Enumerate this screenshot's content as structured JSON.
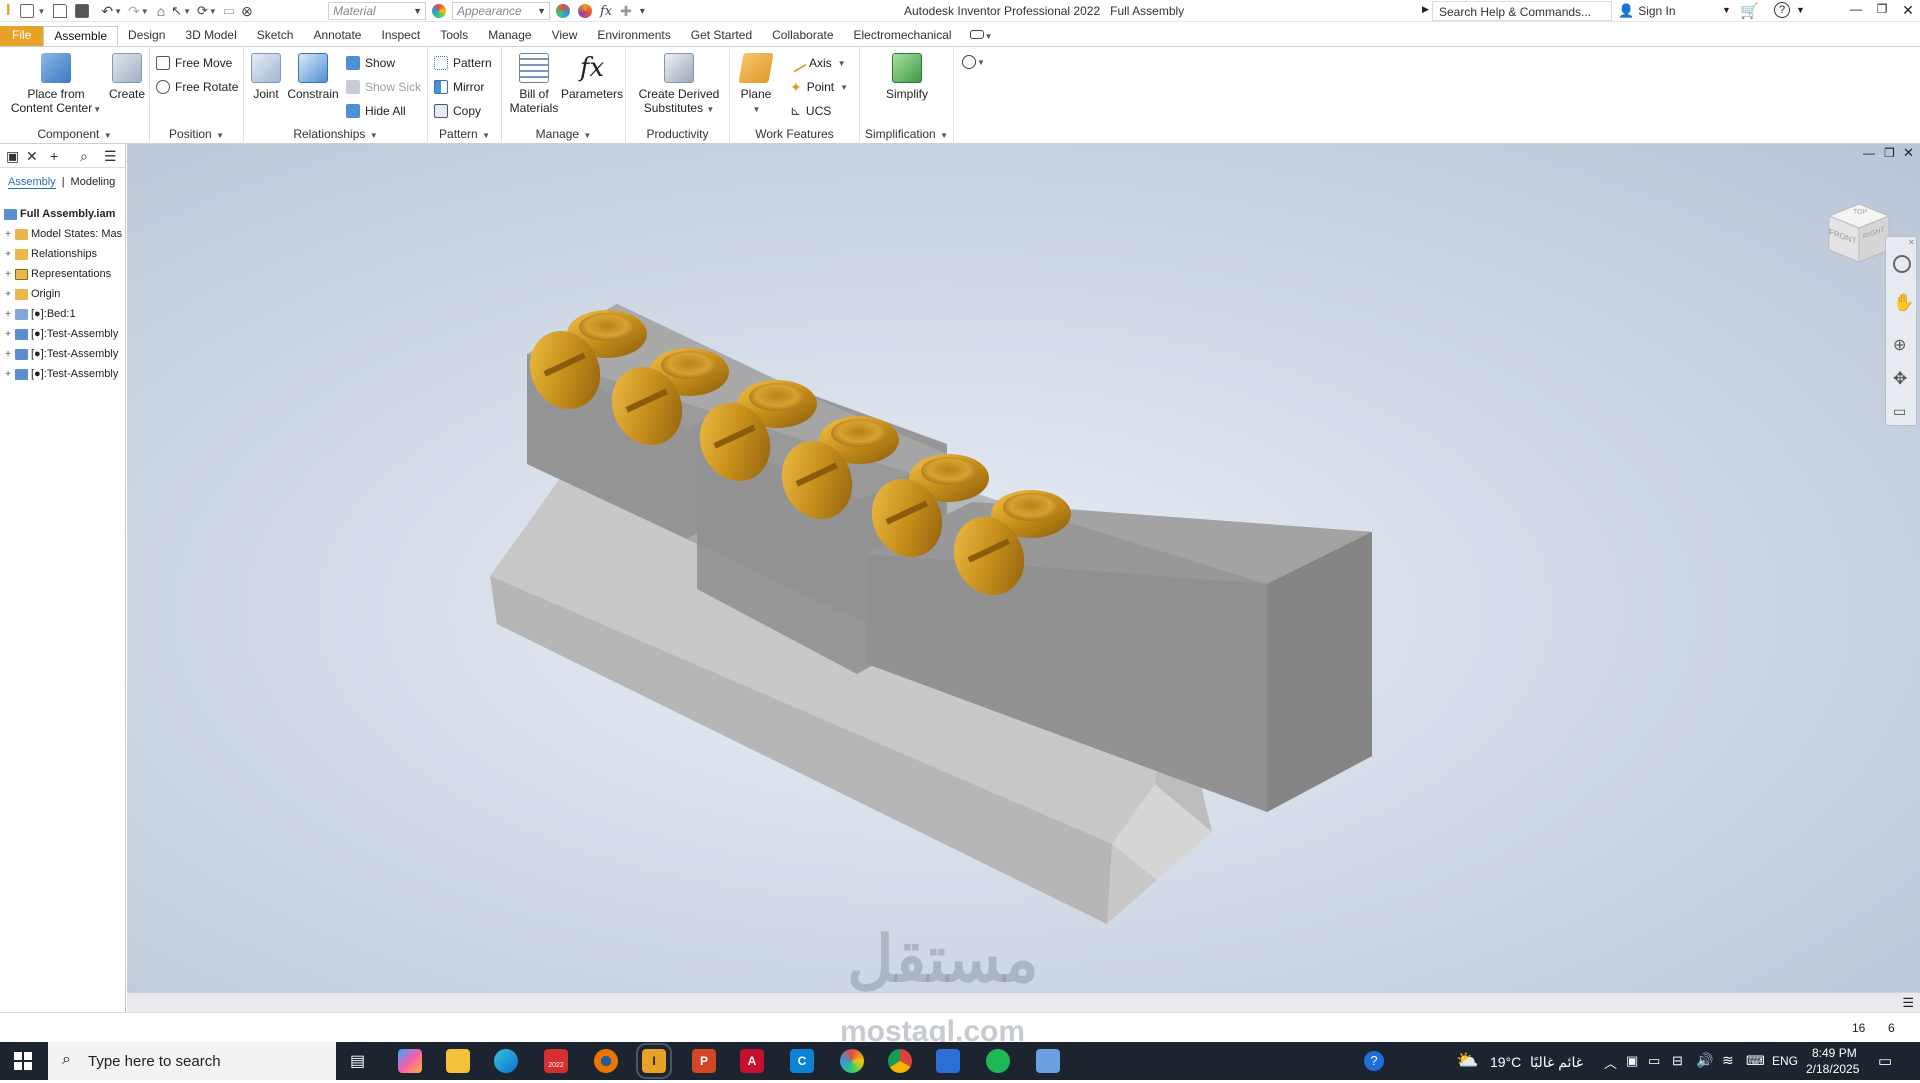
{
  "titlebar": {
    "app_title": "Autodesk Inventor Professional 2022",
    "doc_title": "Full Assembly",
    "material_placeholder": "Material",
    "appearance_placeholder": "Appearance",
    "search_help": "Search Help & Commands...",
    "sign_in": "Sign In"
  },
  "tabs": [
    "File",
    "Assemble",
    "Design",
    "3D Model",
    "Sketch",
    "Annotate",
    "Inspect",
    "Tools",
    "Manage",
    "View",
    "Environments",
    "Get Started",
    "Collaborate",
    "Electromechanical"
  ],
  "active_tab": "Assemble",
  "ribbon": {
    "component": {
      "label": "Component",
      "place_line1": "Place from",
      "place_line2": "Content Center",
      "create": "Create"
    },
    "position": {
      "label": "Position",
      "free_move": "Free Move",
      "free_rotate": "Free Rotate"
    },
    "relationships": {
      "label": "Relationships",
      "joint": "Joint",
      "constrain": "Constrain",
      "show": "Show",
      "show_sick": "Show Sick",
      "hide_all": "Hide All"
    },
    "pattern": {
      "label": "Pattern",
      "pattern": "Pattern",
      "mirror": "Mirror",
      "copy": "Copy"
    },
    "manage": {
      "label": "Manage",
      "bom_line1": "Bill of",
      "bom_line2": "Materials",
      "parameters": "Parameters"
    },
    "productivity": {
      "label": "Productivity",
      "cds_line1": "Create Derived",
      "cds_line2": "Substitutes"
    },
    "work_features": {
      "label": "Work Features",
      "plane": "Plane",
      "axis": "Axis",
      "point": "Point",
      "ucs": "UCS"
    },
    "simplification": {
      "label": "Simplification",
      "simplify": "Simplify"
    }
  },
  "browser": {
    "tabs": [
      "Assembly",
      "Modeling"
    ],
    "nodes": [
      {
        "label": "Full Assembly.iam",
        "root": true
      },
      {
        "label": "Model States: Mas"
      },
      {
        "label": "Relationships"
      },
      {
        "label": "Representations"
      },
      {
        "label": "Origin"
      },
      {
        "label": "[●]:Bed:1"
      },
      {
        "label": "[●]:Test-Assembly"
      },
      {
        "label": "[●]:Test-Assembly"
      },
      {
        "label": "[●]:Test-Assembly"
      }
    ]
  },
  "viewcube": {
    "front": "FRONT",
    "right": "RIGHT",
    "top": "TOP"
  },
  "bottom_status": {
    "count1": "16",
    "count2": "6"
  },
  "taskbar": {
    "search": "Type here to search",
    "temperature": "19°C",
    "weather_text": "غائم غالبًا",
    "lang": "ENG",
    "time": "8:49 PM",
    "date": "2/18/2025",
    "sw_year": "2022"
  },
  "watermark": {
    "arabic": "مستقل",
    "latin": "mostaql.com"
  },
  "colors": {
    "file_tab": "#e8a227",
    "gold": "#d9a021",
    "part_gray": "#9a9a9a",
    "bed_gray": "#c6c6c6",
    "taskbar": "#1c2430"
  }
}
